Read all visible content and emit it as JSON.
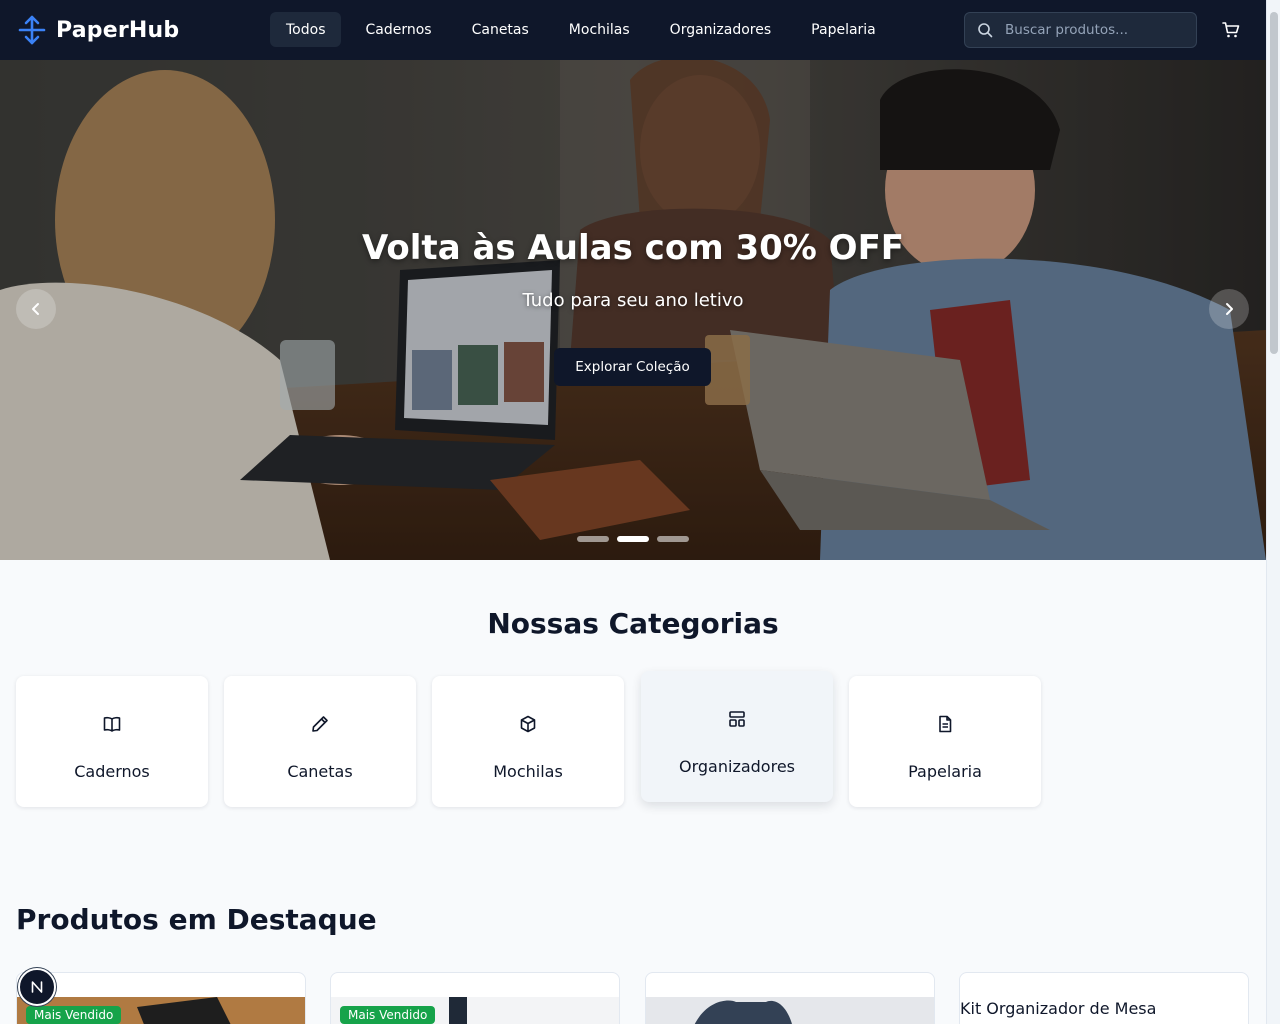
{
  "brand": {
    "name": "PaperHub",
    "accent": "#3b82f6"
  },
  "nav": {
    "items": [
      {
        "label": "Todos",
        "active": true
      },
      {
        "label": "Cadernos"
      },
      {
        "label": "Canetas"
      },
      {
        "label": "Mochilas"
      },
      {
        "label": "Organizadores"
      },
      {
        "label": "Papelaria"
      }
    ]
  },
  "search": {
    "placeholder": "Buscar produtos..."
  },
  "hero": {
    "title": "Volta às Aulas com 30% OFF",
    "subtitle": "Tudo para seu ano letivo",
    "cta": "Explorar Coleção",
    "slides": 3,
    "active_slide": 2
  },
  "categories": {
    "title": "Nossas Categorias",
    "items": [
      {
        "label": "Cadernos",
        "icon": "book-open-icon"
      },
      {
        "label": "Canetas",
        "icon": "pencil-icon"
      },
      {
        "label": "Mochilas",
        "icon": "package-icon"
      },
      {
        "label": "Organizadores",
        "icon": "layout-icon"
      },
      {
        "label": "Papelaria",
        "icon": "file-text-icon"
      }
    ]
  },
  "featured": {
    "title": "Produtos em Destaque",
    "products": [
      {
        "badge": "Mais Vendido"
      },
      {
        "badge": "Mais Vendido"
      },
      {
        "badge": ""
      },
      {
        "image_alt": "Kit Organizador de Mesa"
      }
    ]
  },
  "colors": {
    "header_bg": "#0f172a",
    "badge_green": "#16a34a",
    "page_bg": "#f8fafc"
  }
}
